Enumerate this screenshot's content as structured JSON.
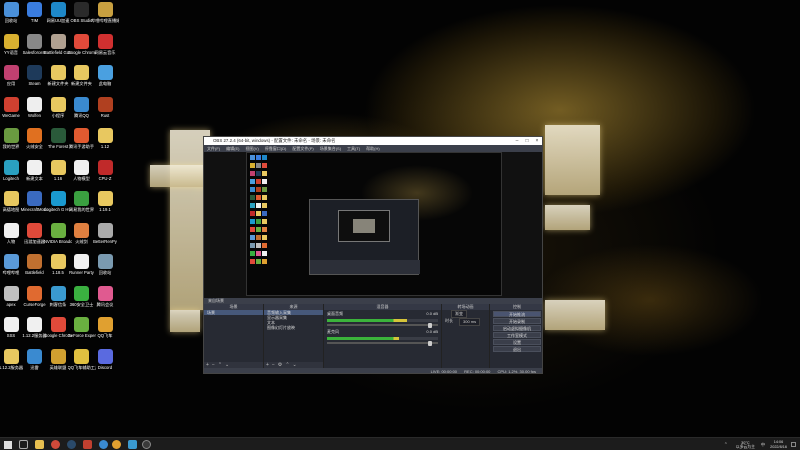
{
  "desktop": {
    "icons": [
      {
        "label": "回收站",
        "color": "#4a90d9"
      },
      {
        "label": "TIM",
        "color": "#3a7de0"
      },
      {
        "label": "网易UU加速",
        "color": "#1e88c8"
      },
      {
        "label": "OBS Studio",
        "color": "#2a2a2a"
      },
      {
        "label": "哔哩哔哩直播姬",
        "color": "#c8a040"
      },
      {
        "label": "YY语音",
        "color": "#d8b030"
      },
      {
        "label": "SalesforceSI",
        "color": "#888888"
      },
      {
        "label": "Battlefield Games",
        "color": "#b0a090"
      },
      {
        "label": "Google Chrome",
        "color": "#e04a3a"
      },
      {
        "label": "网易云音乐",
        "color": "#d03030"
      },
      {
        "label": "应用",
        "color": "#c04070"
      },
      {
        "label": "Steam",
        "color": "#1e3a5a"
      },
      {
        "label": "新建文件夹",
        "color": "#e8c860"
      },
      {
        "label": "新建文件夹",
        "color": "#e8c860"
      },
      {
        "label": "此电脑",
        "color": "#4aa0e0"
      },
      {
        "label": "WeGame",
        "color": "#d04030"
      },
      {
        "label": "Wolfen",
        "color": "#eeeeee"
      },
      {
        "label": "小程序",
        "color": "#e8c860"
      },
      {
        "label": "腾讯QQ",
        "color": "#3a8ad0"
      },
      {
        "label": "Rust",
        "color": "#b04020"
      },
      {
        "label": "我的世界",
        "color": "#6a9a40"
      },
      {
        "label": "火绒安全",
        "color": "#e07020"
      },
      {
        "label": "The Forest",
        "color": "#2a5a3a"
      },
      {
        "label": "腾讯手游助手",
        "color": "#e05a30"
      },
      {
        "label": "1.12",
        "color": "#e8c860"
      },
      {
        "label": "Logitech",
        "color": "#2aa0c0"
      },
      {
        "label": "新建文本",
        "color": "#f0f0f0"
      },
      {
        "label": "1.16",
        "color": "#e8c860"
      },
      {
        "label": "人物模型",
        "color": "#f0f0f0"
      },
      {
        "label": "CPU-Z",
        "color": "#c02a2a"
      },
      {
        "label": "高德地图",
        "color": "#e8c860"
      },
      {
        "label": "MinecraftMods",
        "color": "#3a6ac0"
      },
      {
        "label": "Logitech G HUB",
        "color": "#1a9ad0"
      },
      {
        "label": "网易我的世界",
        "color": "#3aa040"
      },
      {
        "label": "1.19.1",
        "color": "#e8c860"
      },
      {
        "label": "人物",
        "color": "#f0f0f0"
      },
      {
        "label": "迅游加速器",
        "color": "#e04a3a"
      },
      {
        "label": "NVIDIA Broadcast",
        "color": "#6ab040"
      },
      {
        "label": "火绒剑",
        "color": "#e08040"
      },
      {
        "label": "BetterRenPy",
        "color": "#aaaaaa"
      },
      {
        "label": "哔哩哔哩",
        "color": "#5a9ad8"
      },
      {
        "label": "Battlefield",
        "color": "#c07030"
      },
      {
        "label": "1.18.5",
        "color": "#e8c860"
      },
      {
        "label": "Runner Party",
        "color": "#f0f0f0"
      },
      {
        "label": "回收站",
        "color": "#7a9ab0"
      },
      {
        "label": "apex",
        "color": "#c0c0c0"
      },
      {
        "label": "CurseForge",
        "color": "#e06a30"
      },
      {
        "label": "刺客信条",
        "color": "#3a9ad0"
      },
      {
        "label": "360安全卫士",
        "color": "#3ab040"
      },
      {
        "label": "腾讯会议",
        "color": "#e05a90"
      },
      {
        "label": "SSS",
        "color": "#f0f0f0"
      },
      {
        "label": "1.12.2服务器",
        "color": "#f0f0f0"
      },
      {
        "label": "Google Chrome",
        "color": "#e04a3a"
      },
      {
        "label": "GeForce Experience",
        "color": "#6ab040"
      },
      {
        "label": "QQ飞车",
        "color": "#e0a030"
      },
      {
        "label": "1.12.2服务器",
        "color": "#e8c860"
      },
      {
        "label": "迅雷",
        "color": "#3a8ad0"
      },
      {
        "label": "英雄联盟",
        "color": "#d0a030"
      },
      {
        "label": "QQ飞车辅助工具",
        "color": "#e0c040"
      },
      {
        "label": "Discord",
        "color": "#5a6ae0"
      }
    ]
  },
  "obs": {
    "title": "OBS 27.2.4 (64-bit, windows) - 配置文件: 未命名 - 场景: 未命名",
    "menu": [
      "文件(F)",
      "编辑(E)",
      "视图(V)",
      "停靠窗口(D)",
      "配置文件(P)",
      "场景集合(S)",
      "工具(T)",
      "帮助(H)"
    ],
    "current_scene_label": "来自场景",
    "docks": {
      "scenes": {
        "title": "场景",
        "items": [
          "场景"
        ]
      },
      "sources": {
        "title": "来源",
        "items": [
          "音频输入采集",
          "显示器采集",
          "文本",
          "图像幻灯片放映"
        ]
      },
      "mixer": {
        "title": "混音器",
        "channels": [
          {
            "name": "桌面音频",
            "db": "0.0 dB",
            "level": 0.72,
            "slider": 0.95
          },
          {
            "name": "麦克风",
            "db": "0.0 dB",
            "level": 0.65,
            "slider": 0.95
          }
        ]
      },
      "transitions": {
        "title": "转场动画",
        "type_label": "渐变",
        "duration_label": "时长",
        "duration_value": "300 ms"
      },
      "controls": {
        "title": "控制",
        "buttons": [
          "开始推流",
          "开始录制",
          "启动虚拟摄像机",
          "工作室模式",
          "设置",
          "退出"
        ]
      }
    },
    "status": {
      "live": "LIVE: 00:00:00",
      "rec": "REC: 00:00:00",
      "cpu": "CPU: 1.2%, 30.00 fps"
    }
  },
  "taskbar": {
    "weather_line1": "30°C",
    "weather_line2": "以多云为主",
    "ime": "中",
    "time": "14:06",
    "date": "2022/8/16"
  },
  "colors": {
    "accent": "#46587a",
    "obs_bg": "#2b2e38",
    "meter_green": "#3bb33b",
    "meter_yellow": "#d6c43a",
    "meter_red": "#c63b3b"
  }
}
